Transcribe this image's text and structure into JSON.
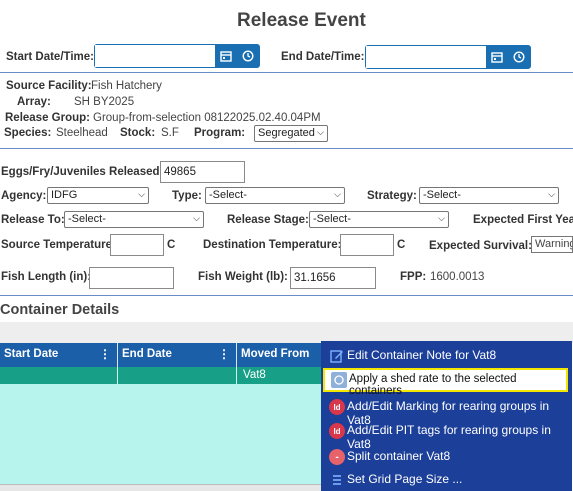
{
  "title": "Release Event",
  "dates": {
    "start_label": "Start Date/Time:",
    "start_value": "",
    "end_label": "End Date/Time:",
    "end_value": ""
  },
  "info": {
    "source_facility_label": "Source Facility:",
    "source_facility_value": "Fish Hatchery",
    "array_label": "Array:",
    "array_value": "SH BY2025",
    "release_group_label": "Release Group:",
    "release_group_value": "Group-from-selection 08122025.02.40.04PM",
    "species_label": "Species:",
    "species_value": "Steelhead",
    "stock_label": "Stock:",
    "stock_value": "S.F",
    "program_label": "Program:",
    "program_value": "Segregated"
  },
  "form": {
    "released_label": "Eggs/Fry/Juveniles Released:",
    "released_value": "49865",
    "agency_label": "Agency:",
    "agency_value": "IDFG",
    "type_label": "Type:",
    "type_value": "-Select-",
    "strategy_label": "Strategy:",
    "strategy_value": "-Select-",
    "release_to_label": "Release To:",
    "release_to_value": "-Select-",
    "release_stage_label": "Release Stage:",
    "release_stage_value": "-Select-",
    "expected_first_year_label": "Expected First Yea",
    "source_temp_label": "Source Temperature:",
    "source_temp_value": "",
    "source_temp_unit": "C",
    "dest_temp_label": "Destination Temperature:",
    "dest_temp_value": "",
    "dest_temp_unit": "C",
    "expected_survival_label": "Expected Survival:",
    "expected_survival_value": "Warning",
    "fish_length_label": "Fish Length  (in):",
    "fish_length_value": "",
    "fish_weight_label": "Fish Weight  (lb):",
    "fish_weight_value": "31.1656",
    "fpp_label": "FPP:",
    "fpp_value": "1600.0013"
  },
  "container": {
    "section_title": "Container Details",
    "columns": [
      "Start Date",
      "End Date",
      "Moved From"
    ],
    "rows": [
      {
        "start_date": "",
        "end_date": "",
        "moved_from": "Vat8"
      }
    ]
  },
  "context_menu": {
    "items": [
      {
        "label": "Edit Container Note for Vat8",
        "icon": "edit-note-icon"
      },
      {
        "label": "Apply a shed rate to the selected containers",
        "icon": "shed-rate-icon",
        "highlighted": true
      },
      {
        "label": "Add/Edit Marking for rearing groups in Vat8",
        "icon": "marking-icon"
      },
      {
        "label": "Add/Edit PIT tags for rearing groups in Vat8",
        "icon": "pit-tag-icon"
      },
      {
        "label": "Split container Vat8",
        "icon": "split-icon"
      },
      {
        "label": "Set Grid Page Size ...",
        "icon": "grid-size-icon"
      }
    ]
  },
  "colors": {
    "primary": "#1a6fb3",
    "grid_header": "#1b5fa8",
    "grid_row_selected": "#17a087",
    "grid_body": "#b8f4ee",
    "menu_bg": "#1c3f99",
    "menu_highlight_border": "#f3e600"
  }
}
